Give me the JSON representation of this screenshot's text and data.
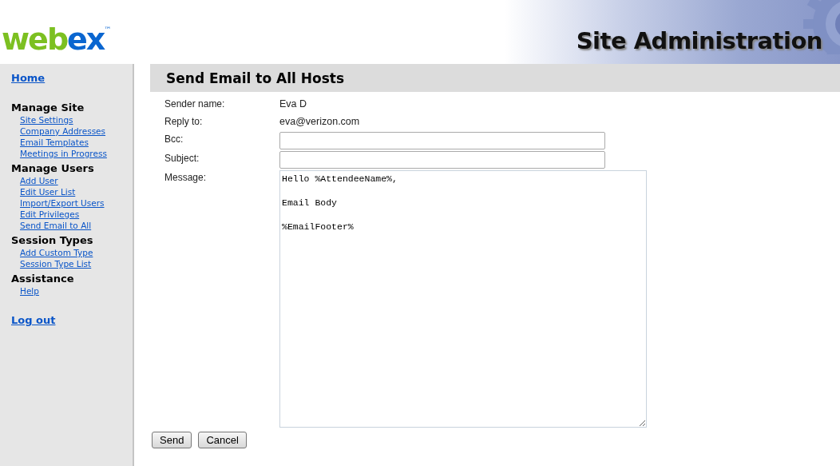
{
  "header": {
    "logo": {
      "part_1": "web",
      "part_2": "ex",
      "mark": "™"
    },
    "title": "Site Administration"
  },
  "sidebar": {
    "home": "Home",
    "sections": [
      {
        "heading": "Manage Site",
        "links": [
          "Site Settings",
          "Company Addresses",
          "Email Templates",
          "Meetings in Progress"
        ]
      },
      {
        "heading": "Manage Users",
        "links": [
          "Add User",
          "Edit User List",
          "Import/Export Users",
          "Edit Privileges",
          "Send Email to All"
        ]
      },
      {
        "heading": "Session Types",
        "links": [
          "Add Custom Type",
          "Session Type List"
        ]
      },
      {
        "heading": "Assistance",
        "links": [
          "Help"
        ]
      }
    ],
    "logout": "Log out"
  },
  "page_title": "Send Email to All Hosts",
  "form": [
    {
      "kind": "text",
      "label": "Sender name:",
      "value": "Eva D"
    },
    {
      "kind": "text",
      "label": "Reply to:",
      "value": "eva@verizon.com"
    },
    {
      "kind": "input",
      "label": "Bcc:"
    },
    {
      "kind": "input",
      "label": "Subject:"
    },
    {
      "kind": "textarea",
      "label": "Message:",
      "value": "Hello %AttendeeName%,\n\nEmail Body\n\n%EmailFooter%"
    }
  ],
  "buttons": [
    "Send",
    "Cancel"
  ]
}
